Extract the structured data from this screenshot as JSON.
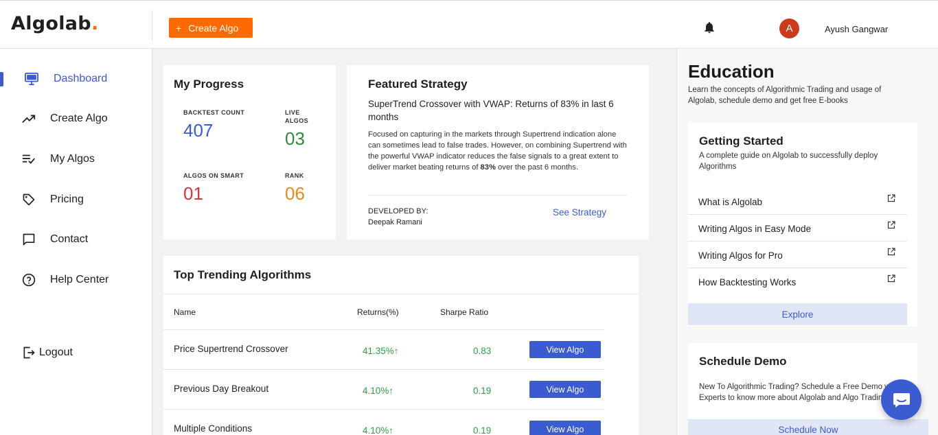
{
  "app": {
    "logo_text": "Algolab",
    "logo_dot": ".",
    "create_button": {
      "icon": "plus",
      "label": "Create Algo"
    },
    "notifications_icon": "bell-icon",
    "user": {
      "avatar_initial": "A",
      "name": "Ayush Gangwar"
    }
  },
  "sidebar": {
    "items": [
      {
        "label": "Dashboard",
        "icon": "monitor-icon",
        "active": true
      },
      {
        "label": "Create Algo",
        "icon": "trend-icon"
      },
      {
        "label": "My Algos",
        "icon": "list-check-icon"
      },
      {
        "label": "Pricing",
        "icon": "tag-icon"
      },
      {
        "label": "Contact",
        "icon": "chat-bubble-icon"
      },
      {
        "label": "Help Center",
        "icon": "help-icon"
      }
    ],
    "logout": {
      "label": "Logout",
      "icon": "logout-icon"
    }
  },
  "progress": {
    "title": "My Progress",
    "stats": [
      {
        "label": "BACKTEST COUNT",
        "value": "407",
        "color": "#3b5bd1"
      },
      {
        "label_line1": "LIVE",
        "label_line2": "ALGOS",
        "value": "03",
        "color": "#2e8b3e"
      },
      {
        "label": "ALGOS ON SMART",
        "value": "01",
        "color": "#d9343a"
      },
      {
        "label": "RANK",
        "value": "06",
        "color": "#e38a1c"
      }
    ]
  },
  "featured": {
    "title": "Featured Strategy",
    "subtitle": "SuperTrend Crossover with VWAP: Returns of 83% in last 6 months",
    "description_pre": "Focused on capturing in the markets through Supertrend indication alone can sometimes lead to false trades. However, on combining Supertrend with the powerful VWAP indicator reduces the false signals to a great extent to deliver market beating returns of ",
    "description_bold": "83%",
    "description_post": " over the past 6 months.",
    "developed_by_label": "DEVELOPED BY:",
    "developer": "Deepak Ramani",
    "see_strategy": "See Strategy"
  },
  "trending": {
    "title": "Top Trending Algorithms",
    "columns": [
      "Name",
      "Returns(%)",
      "Sharpe Ratio"
    ],
    "rows": [
      {
        "name": "Price Supertrend Crossover",
        "returns": "41.35%",
        "sharpe": "0.83",
        "action": "View Algo"
      },
      {
        "name": "Previous Day Breakout",
        "returns": "4.10%",
        "sharpe": "0.19",
        "action": "View Algo"
      },
      {
        "name": "Multiple Conditions",
        "returns": "4.10%",
        "sharpe": "0.19",
        "action": "View Algo"
      }
    ]
  },
  "education": {
    "title": "Education",
    "description": "Learn the concepts of Algorithmic Trading and usage of Algolab, schedule demo and get free E-books",
    "getting_started": {
      "title": "Getting Started",
      "description": "A complete guide on Algolab to successfully deploy Algorithms",
      "links": [
        "What is Algolab",
        "Writing Algos in Easy Mode",
        "Writing Algos for Pro",
        "How Backtesting Works"
      ],
      "explore": "Explore"
    },
    "schedule_demo": {
      "title": "Schedule Demo",
      "description": "New To Algorithmic Trading? Schedule a Free Demo with our Experts to know more about Algolab and Algo Trading",
      "button": "Schedule Now"
    }
  },
  "colors": {
    "accent": "#3b5bd1",
    "brand": "#ff6a00",
    "positive": "#2aa148"
  }
}
